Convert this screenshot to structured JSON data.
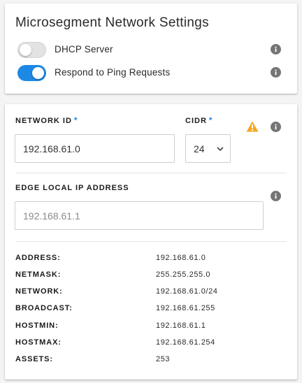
{
  "microsegment": {
    "title": "Microsegment Network Settings",
    "dhcp_label": "DHCP Server",
    "dhcp_on": false,
    "ping_label": "Respond to Ping Requests",
    "ping_on": true
  },
  "network": {
    "network_id_label": "NETWORK ID",
    "required_mark": "*",
    "network_id_value": "192.168.61.0",
    "cidr_label": "CIDR",
    "cidr_value": "24",
    "edge_label": "EDGE LOCAL IP ADDRESS",
    "edge_value": "192.168.61.1"
  },
  "details": {
    "address_key": "ADDRESS:",
    "address_val": "192.168.61.0",
    "netmask_key": "NETMASK:",
    "netmask_val": "255.255.255.0",
    "network_key": "NETWORK:",
    "network_val": "192.168.61.0/24",
    "broadcast_key": "BROADCAST:",
    "broadcast_val": "192.168.61.255",
    "hostmin_key": "HOSTMIN:",
    "hostmin_val": "192.168.61.1",
    "hostmax_key": "HOSTMAX:",
    "hostmax_val": "192.168.61.254",
    "assets_key": "ASSETS:",
    "assets_val": "253"
  },
  "icons": {
    "info": "info-icon",
    "warning": "warning-icon",
    "chevron": "chevron-down-icon"
  },
  "colors": {
    "accent": "#1e88e5",
    "warning": "#f5a623",
    "info_icon": "#757575"
  }
}
